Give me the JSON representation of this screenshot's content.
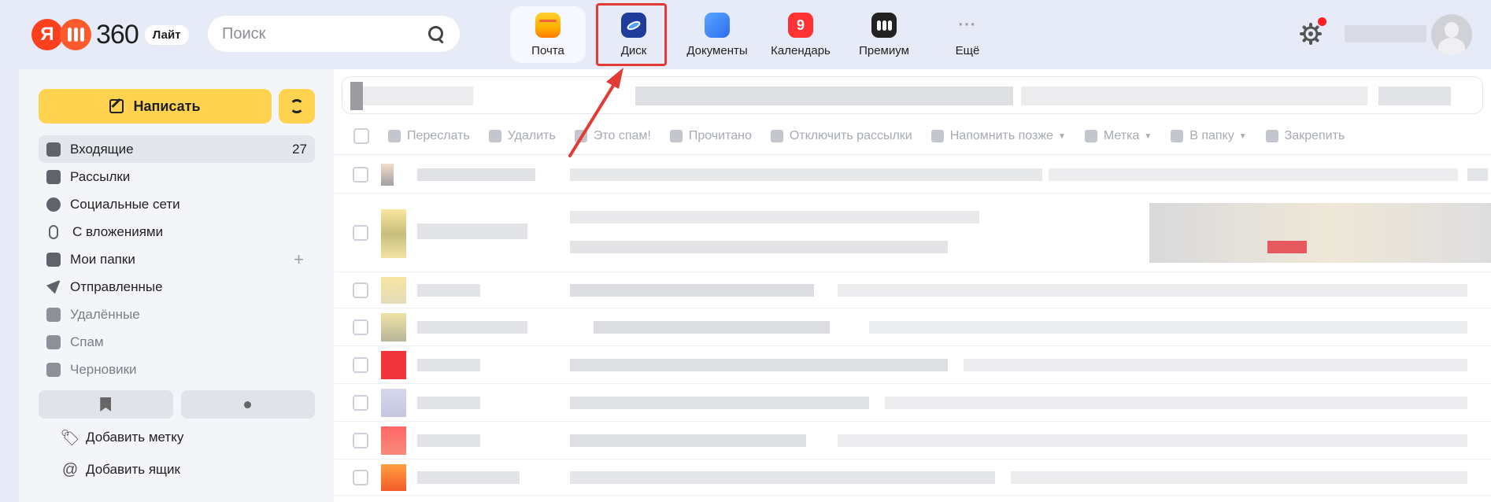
{
  "logo": {
    "ya": "Я",
    "brand": "360",
    "edition": "Лайт"
  },
  "search": {
    "placeholder": "Поиск"
  },
  "services": [
    {
      "label": "Почта",
      "icon": "mail-icon",
      "active": true
    },
    {
      "label": "Диск",
      "icon": "disk-icon",
      "highlighted": true
    },
    {
      "label": "Документы",
      "icon": "docs-icon"
    },
    {
      "label": "Календарь",
      "icon": "calendar-icon",
      "badge": "9"
    },
    {
      "label": "Премиум",
      "icon": "premium-icon"
    },
    {
      "label": "Ещё",
      "icon": "more-icon"
    }
  ],
  "sidebar": {
    "compose_label": "Написать",
    "folders": [
      {
        "label": "Входящие",
        "count": "27",
        "icon": "inbox-icon",
        "active": true
      },
      {
        "label": "Рассылки",
        "icon": "newsletters-icon"
      },
      {
        "label": "Социальные сети",
        "icon": "social-icon"
      },
      {
        "label": "С вложениями",
        "icon": "paperclip-icon"
      },
      {
        "label": "Мои папки",
        "icon": "folder-icon",
        "action": "+"
      },
      {
        "label": "Отправленные",
        "icon": "sent-icon"
      },
      {
        "label": "Удалённые",
        "icon": "trash-icon"
      },
      {
        "label": "Спам",
        "icon": "spam-icon"
      },
      {
        "label": "Черновики",
        "icon": "drafts-icon"
      }
    ],
    "add_label": "Добавить метку",
    "add_mailbox": "Добавить ящик"
  },
  "toolbar": [
    {
      "label": "Переслать",
      "icon": "forward-icon"
    },
    {
      "label": "Удалить",
      "icon": "trash-icon"
    },
    {
      "label": "Это спам!",
      "icon": "spam-icon"
    },
    {
      "label": "Прочитано",
      "icon": "read-icon"
    },
    {
      "label": "Отключить рассылки",
      "icon": "unsubscribe-icon"
    },
    {
      "label": "Напомнить позже",
      "icon": "reminder-icon",
      "dropdown": true
    },
    {
      "label": "Метка",
      "icon": "tag-icon",
      "dropdown": true
    },
    {
      "label": "В папку",
      "icon": "folder-icon",
      "dropdown": true
    },
    {
      "label": "Закрепить",
      "icon": "pin-icon"
    }
  ],
  "colors": {
    "accent": "#ffd34f",
    "highlight": "#e23a34",
    "background": "#e6ebf7"
  }
}
